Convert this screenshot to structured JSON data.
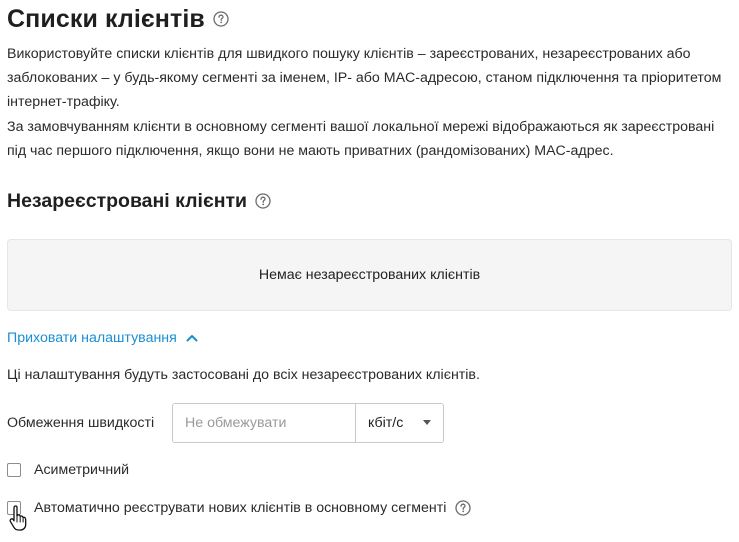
{
  "page": {
    "title": "Списки клієнтів",
    "description": [
      "Використовуйте списки клієнтів для швидкого пошуку клієнтів – зареєстрованих, незареєстрованих або заблокованих – у будь-якому сегменті за іменем, IP- або MAC-адресою, станом підключення та пріоритетом інтернет-трафіку.",
      "За замовчуванням клієнти в основному сегменті вашої локальної мережі відображаються як зареєстровані під час першого підключення, якщо вони не мають приватних (рандомізованих) MAC-адрес."
    ]
  },
  "unregistered": {
    "title": "Незареєстровані клієнти",
    "empty_text": "Немає незареєстрованих клієнтів",
    "toggle_label": "Приховати налаштування",
    "settings_note": "Ці налаштування будуть застосовані до всіх незареєстрованих клієнтів.",
    "speed_limit": {
      "label": "Обмеження швидкості",
      "placeholder": "Не обмежувати",
      "value": "",
      "unit": "кбіт/с"
    },
    "asymmetric_label": "Асиметричний",
    "asymmetric_checked": false,
    "auto_register_label": "Автоматично реєструвати нових клієнтів в основному сегменті",
    "auto_register_checked": false
  },
  "icons": {
    "help": "question-circle-icon",
    "toggle": "chevron-up-icon",
    "select": "caret-down-icon",
    "cursor": "hand-pointer-icon"
  },
  "colors": {
    "link": "#1a8fd1",
    "text": "#1f1f1f",
    "empty_box_bg": "#f5f5f5"
  }
}
